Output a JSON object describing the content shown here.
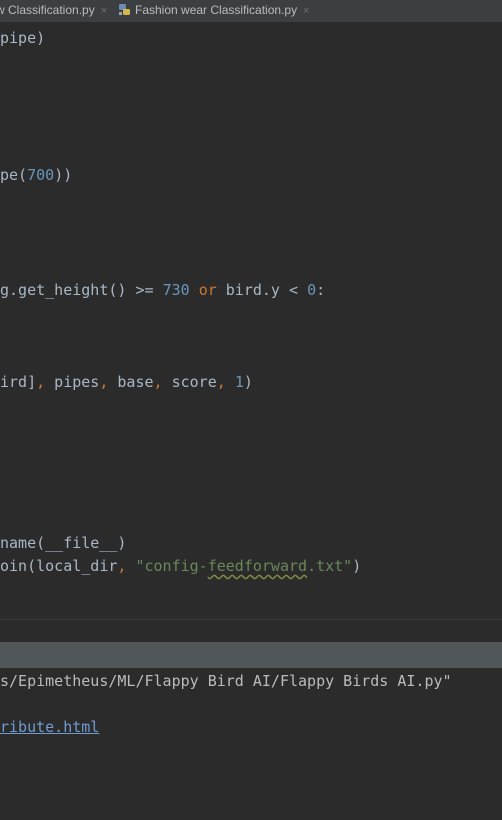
{
  "tabs": [
    {
      "label": "w Classification.py",
      "close": "×"
    },
    {
      "label": "Fashion wear Classification.py",
      "close": "×"
    }
  ],
  "editor": {
    "lines": {
      "l1": "pipe)",
      "l2_a": "pe(",
      "l2_num": "700",
      "l2_b": "))",
      "l3_a": "g.get_height() >= ",
      "l3_num1": "730",
      "l3_sp": " ",
      "l3_or": "or",
      "l3_b": " bird.y < ",
      "l3_num2": "0",
      "l3_c": ":",
      "l4_a": "ird]",
      "l4_c1": ",",
      "l4_b": " pipes",
      "l4_c2": ",",
      "l4_c": " base",
      "l4_c3": ",",
      "l4_d": " score",
      "l4_c4": ",",
      "l4_sp": " ",
      "l4_num": "1",
      "l4_e": ")",
      "l5": "name(__file__)",
      "l6_a": "oin(local_dir",
      "l6_c": ",",
      "l6_sp": " ",
      "l6_s1": "\"config-",
      "l6_sq": "feedforward",
      "l6_s2": ".txt\"",
      "l6_e": ")"
    }
  },
  "console": {
    "path": "s/Epimetheus/ML/Flappy Bird AI/Flappy Birds AI.py\"",
    "link": "ribute.html"
  },
  "colors": {
    "background": "#2b2b2b",
    "keyword": "#cc7832",
    "number": "#6897bb",
    "string": "#6a8759",
    "text": "#a9b7c6"
  }
}
